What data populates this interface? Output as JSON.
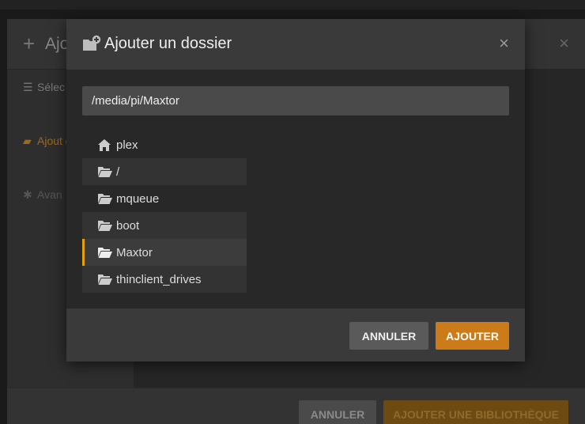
{
  "background_dialog": {
    "title": "Ajo",
    "close_glyph": "×",
    "steps": [
      {
        "icon": "list-icon",
        "label": "Sélec un type"
      },
      {
        "icon": "folder-open-icon",
        "label": "Ajout dossiers"
      },
      {
        "icon": "gear-icon",
        "label": "Avan"
      }
    ],
    "cancel_label": "ANNULER",
    "add_library_label": "AJOUTER UNE BIBLIOTHÈQUE"
  },
  "modal": {
    "icon": "folder-add-icon",
    "title": "Ajouter un dossier",
    "close_glyph": "×",
    "path_value": "/media/pi/Maxtor",
    "folders": [
      {
        "icon": "home-icon",
        "label": "plex",
        "selected": false
      },
      {
        "icon": "folder-open-icon",
        "label": "/",
        "selected": false
      },
      {
        "icon": "folder-open-icon",
        "label": "mqueue",
        "selected": false
      },
      {
        "icon": "folder-open-icon",
        "label": "boot",
        "selected": false
      },
      {
        "icon": "folder-open-icon",
        "label": "Maxtor",
        "selected": true
      },
      {
        "icon": "folder-open-icon",
        "label": "thinclient_drives",
        "selected": false
      }
    ],
    "cancel_label": "ANNULER",
    "add_label": "AJOUTER"
  },
  "colors": {
    "accent": "#e5a00d",
    "add_button": "#cc7b19",
    "modal_header": "#3a3a3a",
    "modal_body": "#282828"
  }
}
